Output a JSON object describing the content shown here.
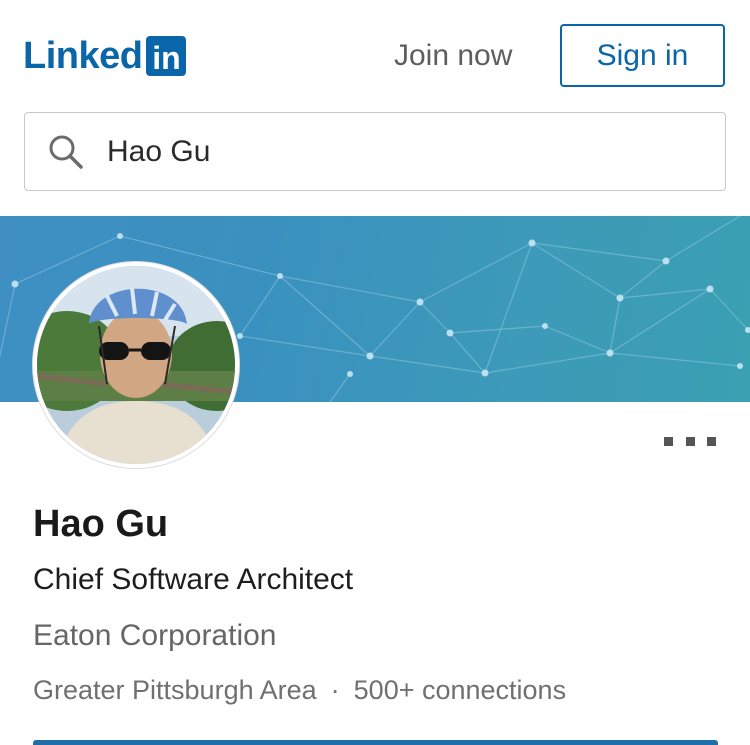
{
  "header": {
    "logo_text": "Linked",
    "logo_box": "in",
    "join_label": "Join now",
    "signin_label": "Sign in"
  },
  "search": {
    "value": "Hao Gu",
    "icon": "search-icon"
  },
  "profile": {
    "name": "Hao Gu",
    "headline": "Chief Software Architect",
    "company": "Eaton Corporation",
    "location": "Greater Pittsburgh Area",
    "separator": "·",
    "connections": "500+ connections",
    "more_icon": "more-horizontal-icon"
  },
  "colors": {
    "brand": "#0a66a8",
    "banner": "#3d93c0"
  }
}
